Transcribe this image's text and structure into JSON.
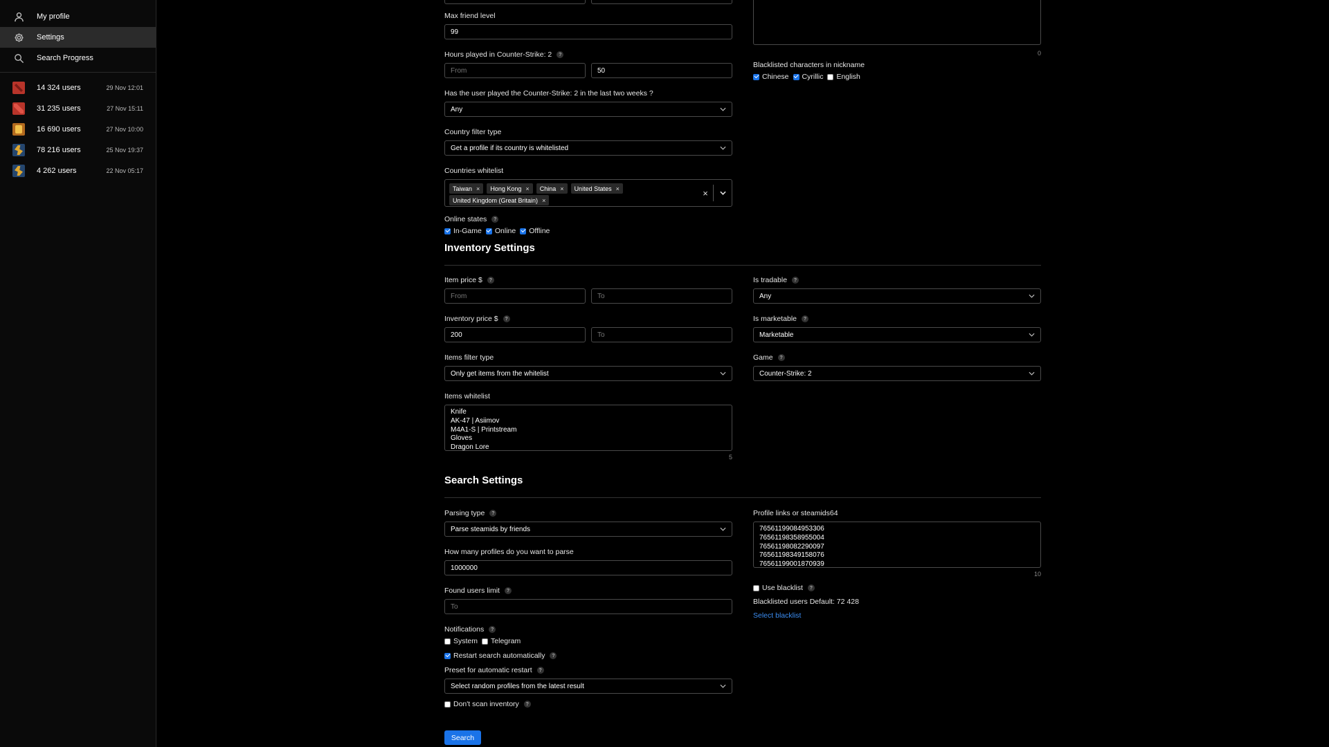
{
  "sidebar": {
    "nav": [
      {
        "label": "My profile",
        "icon": "user-icon"
      },
      {
        "label": "Settings",
        "icon": "gear-icon"
      },
      {
        "label": "Search Progress",
        "icon": "search-icon"
      }
    ],
    "history": [
      {
        "users": "14 324 users",
        "date": "29 Nov 12:01",
        "icon": "dota-icon"
      },
      {
        "users": "31 235 users",
        "date": "27 Nov 15:11",
        "icon": "dota-icon"
      },
      {
        "users": "16 690 users",
        "date": "27 Nov 10:00",
        "icon": "tf2-icon"
      },
      {
        "users": "78 216 users",
        "date": "25 Nov 19:37",
        "icon": "cs2-icon"
      },
      {
        "users": "4 262 users",
        "date": "22 Nov 05:17",
        "icon": "cs2-icon"
      }
    ]
  },
  "profile": {
    "max_friend_level_label": "Max friend level",
    "max_friend_level_value": "99",
    "hours_label": "Hours played in Counter-Strike: 2",
    "hours_from_placeholder": "From",
    "hours_to_value": "50",
    "played_recent_label": "Has the user played the Counter-Strike: 2 in the last two weeks ?",
    "played_recent_value": "Any",
    "country_filter_label": "Country filter type",
    "country_filter_value": "Get a profile if its country is whitelisted",
    "countries_label": "Countries whitelist",
    "countries": [
      "Taiwan",
      "Hong Kong",
      "China",
      "United States",
      "United Kingdom (Great Britain)"
    ],
    "tag_remove": "×",
    "clear_glyph": "×",
    "online_label": "Online states",
    "online_states": [
      {
        "label": "In-Game",
        "checked": true
      },
      {
        "label": "Online",
        "checked": true
      },
      {
        "label": "Offline",
        "checked": true
      }
    ],
    "nickname_counter": "0",
    "blacklist_chars_label": "Blacklisted characters in nickname",
    "blacklist_chars": [
      {
        "label": "Chinese",
        "checked": true
      },
      {
        "label": "Cyrillic",
        "checked": true
      },
      {
        "label": "English",
        "checked": false
      }
    ]
  },
  "inventory": {
    "title": "Inventory Settings",
    "item_price_label": "Item price $",
    "item_price_from_placeholder": "From",
    "item_price_to_placeholder": "To",
    "inv_price_label": "Inventory price $",
    "inv_price_from_value": "200",
    "inv_price_to_placeholder": "To",
    "items_filter_label": "Items filter type",
    "items_filter_value": "Only get items from the whitelist",
    "items_whitelist_label": "Items whitelist",
    "items": [
      "Knife",
      "AK-47 | Asiimov",
      "M4A1-S | Printstream",
      "Gloves",
      "Dragon Lore"
    ],
    "items_counter": "5",
    "tradable_label": "Is tradable",
    "tradable_value": "Any",
    "marketable_label": "Is marketable",
    "marketable_value": "Marketable",
    "game_label": "Game",
    "game_value": "Counter-Strike: 2"
  },
  "search": {
    "title": "Search Settings",
    "parsing_label": "Parsing type",
    "parsing_value": "Parse steamids by friends",
    "profiles_count_label": "How many profiles do you want to parse",
    "profiles_count_value": "1000000",
    "found_limit_label": "Found users limit",
    "found_limit_placeholder": "To",
    "notifications_label": "Notifications",
    "notifications": [
      {
        "label": "System",
        "checked": false
      },
      {
        "label": "Telegram",
        "checked": false
      }
    ],
    "restart_label": "Restart search automatically",
    "restart_checked": true,
    "preset_label": "Preset for automatic restart",
    "preset_value": "Select random profiles from the latest result",
    "dont_scan_label": "Don't scan inventory",
    "dont_scan_checked": false,
    "profile_links_label": "Profile links or steamids64",
    "steamids": [
      "76561199084953306",
      "76561198358955004",
      "76561198082290097",
      "76561198349158076",
      "76561199001870939"
    ],
    "steamids_counter": "10",
    "use_blacklist_label": "Use blacklist",
    "use_blacklist_checked": false,
    "blacklisted_default": "Blacklisted users Default: 72 428",
    "select_blacklist": "Select blacklist",
    "search_button": "Search"
  },
  "help_glyph": "?",
  "accent_color": "#1a73e8"
}
